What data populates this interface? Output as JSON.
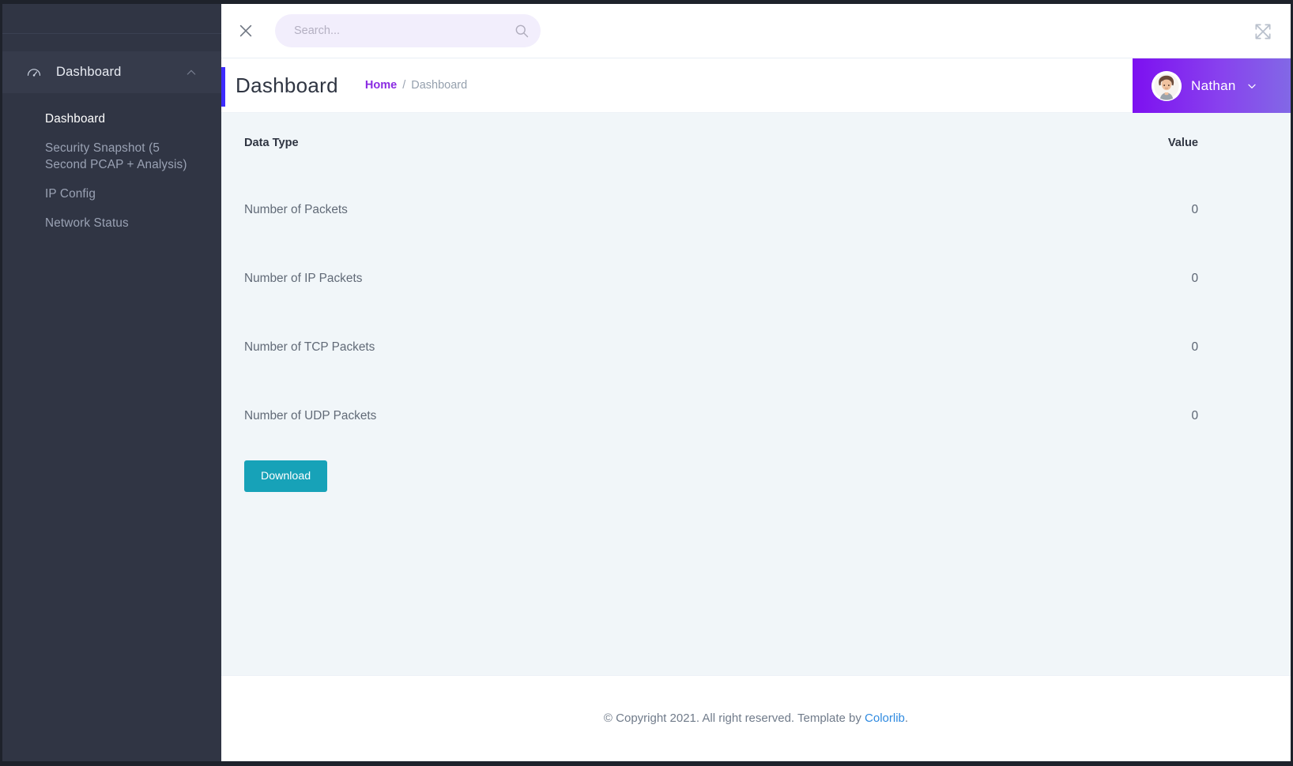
{
  "sidebar": {
    "menu_group": {
      "label": "Dashboard",
      "icon": "gauge-icon",
      "collapse_icon": "chevron-up-icon",
      "expanded": true
    },
    "items": [
      {
        "label": "Dashboard",
        "active": true
      },
      {
        "label": "Security Snapshot (5 Second PCAP + Analysis)",
        "active": false
      },
      {
        "label": "IP Config",
        "active": false
      },
      {
        "label": "Network Status",
        "active": false
      }
    ]
  },
  "topbar": {
    "close_icon": "close-icon",
    "search": {
      "placeholder": "Search...",
      "value": "",
      "icon": "search-icon"
    },
    "expand_icon": "expand-icon"
  },
  "pagehead": {
    "title": "Dashboard",
    "breadcrumb": {
      "home": "Home",
      "separator": "/",
      "current": "Dashboard"
    },
    "accent_color": "#3d2bff"
  },
  "profile": {
    "name": "Nathan",
    "chevron_icon": "chevron-down-icon",
    "avatar_icon": "avatar",
    "gradient_from": "#7d10f0",
    "gradient_to": "#8268e6"
  },
  "main": {
    "table": {
      "columns": [
        "Data Type",
        "Value"
      ],
      "rows": [
        {
          "type": "Number of Packets",
          "value": "0"
        },
        {
          "type": "Number of IP Packets",
          "value": "0"
        },
        {
          "type": "Number of TCP Packets",
          "value": "0"
        },
        {
          "type": "Number of UDP Packets",
          "value": "0"
        }
      ]
    },
    "download_label": "Download",
    "download_color": "#17a2b8"
  },
  "footer": {
    "text": "© Copyright 2021. All right reserved. Template by ",
    "link": "Colorlib",
    "suffix": "."
  }
}
